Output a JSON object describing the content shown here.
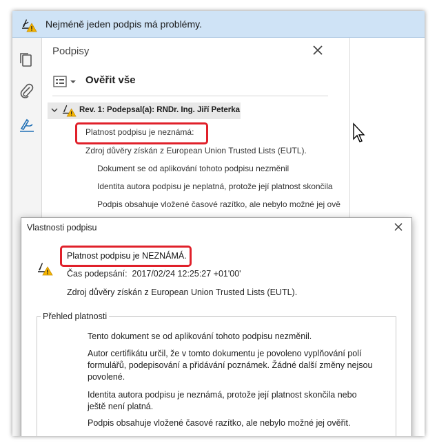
{
  "infobar": {
    "message": "Nejméně jeden podpis má problémy."
  },
  "rail": {
    "items": [
      "copy-pages",
      "attachments",
      "signatures"
    ]
  },
  "panel": {
    "title": "Podpisy",
    "verify_all": "Ověřit vše",
    "revision_label": "Rev. 1: Podepsal(a): RNDr. Ing. Jiří Peterka",
    "status": "Platnost podpisu je neznámá:",
    "trust_source": "Zdroj důvěry získán z European Union Trusted Lists (EUTL).",
    "details": [
      "Dokument se od aplikování tohoto podpisu nezměnil",
      "Identita autora podpisu je neplatná, protože její platnost skončila",
      "Podpis obsahuje vložené časové razítko, ale nebylo možné jej ově"
    ]
  },
  "dialog": {
    "title": "Vlastnosti podpisu",
    "status": "Platnost podpisu je NEZNÁMÁ.",
    "signed_time_label": "Čas podepsání:",
    "signed_time_value": "2017/02/24 12:25:27 +01'00'",
    "trust_source": "Zdroj důvěry získán z European Union Trusted Lists (EUTL).",
    "group_title": "Přehled platnosti",
    "paragraphs": [
      "Tento dokument se od aplikování tohoto podpisu nezměnil.",
      "Autor certifikátu určil, že v tomto dokumentu je povoleno vyplňování polí formulářů, podepisování a přidávání poznámek. Žádné další změny nejsou povolené.",
      "Identita autora podpisu je neznámá, protože její platnost skončila nebo ještě není platná.",
      "Podpis obsahuje vložené časové razítko, ale nebylo možné jej ověřit."
    ]
  },
  "colors": {
    "infobar_bg": "#cfe3f6",
    "highlight": "#e0202a",
    "accent_icon": "#1f6fb5",
    "warning": "#f5b400"
  }
}
